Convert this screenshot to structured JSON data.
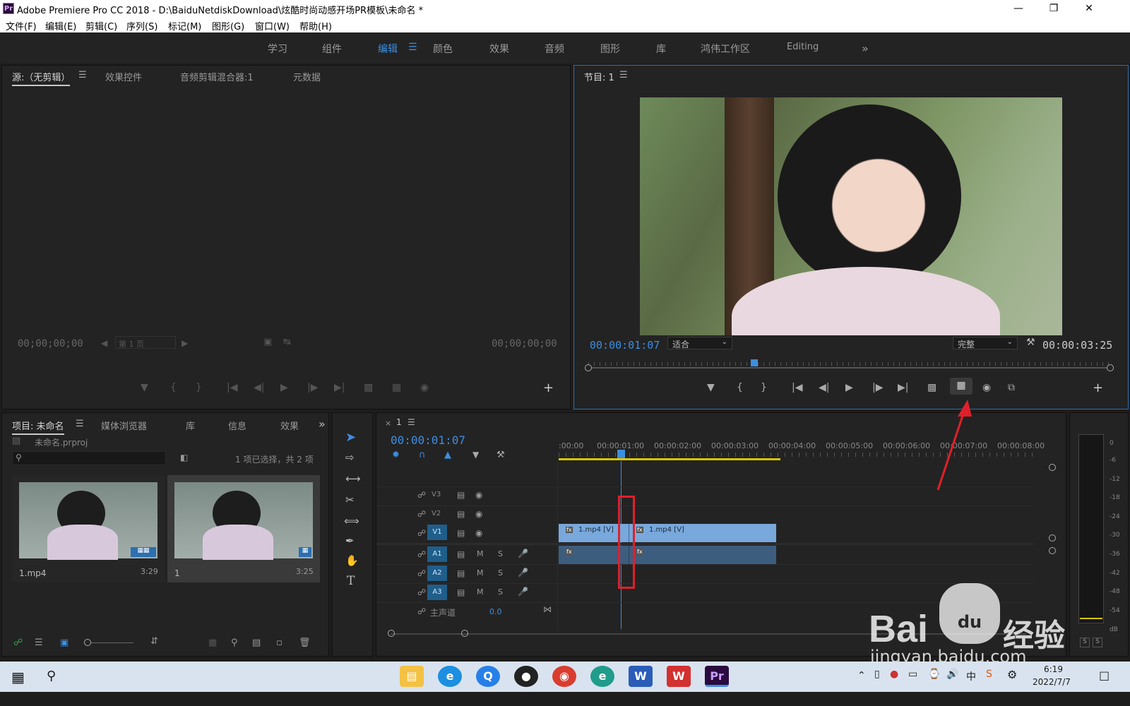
{
  "app": {
    "logo": "Pr",
    "title": "Adobe Premiere Pro CC 2018 - D:\\BaiduNetdiskDownload\\炫酷时尚动感开场PR模板\\未命名 *"
  },
  "menu": [
    "文件(F)",
    "编辑(E)",
    "剪辑(C)",
    "序列(S)",
    "标记(M)",
    "图形(G)",
    "窗口(W)",
    "帮助(H)"
  ],
  "workspaces": [
    "学习",
    "组件",
    "编辑",
    "颜色",
    "效果",
    "音频",
    "图形",
    "库",
    "鸿伟工作区",
    "Editing"
  ],
  "active_workspace": "编辑",
  "source": {
    "tabs": [
      "源:（无剪辑）",
      "效果控件",
      "音频剪辑混合器:1",
      "元数据"
    ],
    "tc_left": "00;00;00;00",
    "tc_right": "00;00;00;00",
    "page": "第 1 页"
  },
  "program": {
    "tab": "节目: 1",
    "tc_current": "00:00:01:07",
    "fit": "适合",
    "quality": "完整",
    "tc_duration": "00:00:03:25"
  },
  "project": {
    "tabs": [
      "项目: 未命名",
      "媒体浏览器",
      "库",
      "信息",
      "效果"
    ],
    "file": "未命名.prproj",
    "selection": "1 项已选择，共 2 项",
    "items": [
      {
        "name": "1.mp4",
        "duration": "3:29"
      },
      {
        "name": "1",
        "duration": "3:25"
      }
    ]
  },
  "timeline": {
    "seq": "1",
    "tc": "00:00:01:07",
    "ruler": [
      ":00:00",
      "00:00:01:00",
      "00:00:02:00",
      "00:00:03:00",
      "00:00:04:00",
      "00:00:05:00",
      "00:00:06:00",
      "00:00:07:00",
      "00:00:08:00"
    ],
    "tracks": [
      {
        "id": "V3"
      },
      {
        "id": "V2"
      },
      {
        "id": "V1"
      },
      {
        "id": "A1"
      },
      {
        "id": "A2"
      },
      {
        "id": "A3"
      }
    ],
    "master": "主声道",
    "master_val": "0.0",
    "clip1": "1.mp4 [V]",
    "clip2": "1.mp4 [V]",
    "fx": "fx",
    "m": "M",
    "s": "S"
  },
  "meter": {
    "scale": [
      "0",
      "-6",
      "-12",
      "-18",
      "-24",
      "-30",
      "-36",
      "-42",
      "-48",
      "-54",
      "dB"
    ],
    "solo": "S"
  },
  "watermark": {
    "line1": "Bai",
    "line2": "du",
    "line3": "经验",
    "url": "jingyan.baidu.com"
  },
  "taskbar": {
    "ime": "中",
    "time": "6:19",
    "date": "2022/7/7"
  }
}
